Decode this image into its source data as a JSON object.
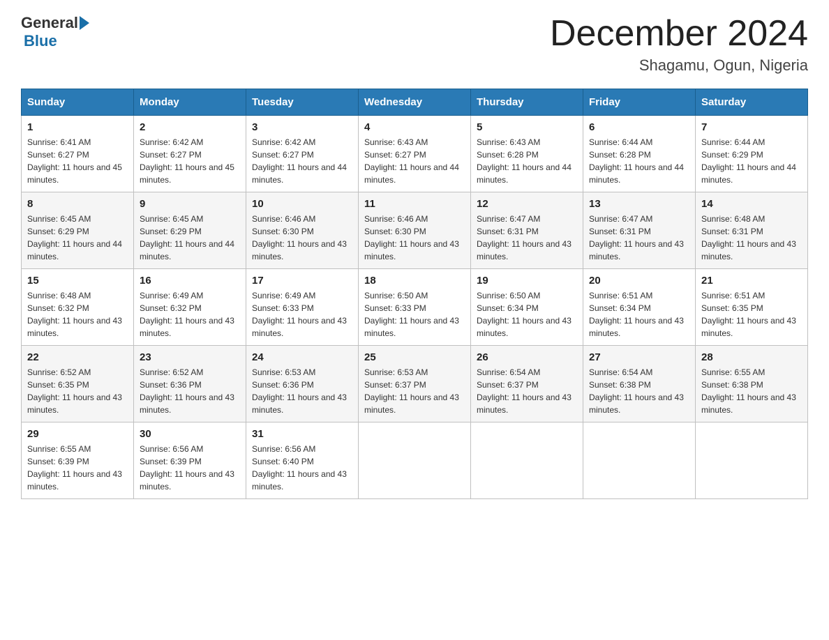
{
  "logo": {
    "general": "General",
    "blue": "Blue"
  },
  "title": "December 2024",
  "subtitle": "Shagamu, Ogun, Nigeria",
  "days_of_week": [
    "Sunday",
    "Monday",
    "Tuesday",
    "Wednesday",
    "Thursday",
    "Friday",
    "Saturday"
  ],
  "weeks": [
    [
      {
        "day": "1",
        "sunrise": "6:41 AM",
        "sunset": "6:27 PM",
        "daylight": "11 hours and 45 minutes."
      },
      {
        "day": "2",
        "sunrise": "6:42 AM",
        "sunset": "6:27 PM",
        "daylight": "11 hours and 45 minutes."
      },
      {
        "day": "3",
        "sunrise": "6:42 AM",
        "sunset": "6:27 PM",
        "daylight": "11 hours and 44 minutes."
      },
      {
        "day": "4",
        "sunrise": "6:43 AM",
        "sunset": "6:27 PM",
        "daylight": "11 hours and 44 minutes."
      },
      {
        "day": "5",
        "sunrise": "6:43 AM",
        "sunset": "6:28 PM",
        "daylight": "11 hours and 44 minutes."
      },
      {
        "day": "6",
        "sunrise": "6:44 AM",
        "sunset": "6:28 PM",
        "daylight": "11 hours and 44 minutes."
      },
      {
        "day": "7",
        "sunrise": "6:44 AM",
        "sunset": "6:29 PM",
        "daylight": "11 hours and 44 minutes."
      }
    ],
    [
      {
        "day": "8",
        "sunrise": "6:45 AM",
        "sunset": "6:29 PM",
        "daylight": "11 hours and 44 minutes."
      },
      {
        "day": "9",
        "sunrise": "6:45 AM",
        "sunset": "6:29 PM",
        "daylight": "11 hours and 44 minutes."
      },
      {
        "day": "10",
        "sunrise": "6:46 AM",
        "sunset": "6:30 PM",
        "daylight": "11 hours and 43 minutes."
      },
      {
        "day": "11",
        "sunrise": "6:46 AM",
        "sunset": "6:30 PM",
        "daylight": "11 hours and 43 minutes."
      },
      {
        "day": "12",
        "sunrise": "6:47 AM",
        "sunset": "6:31 PM",
        "daylight": "11 hours and 43 minutes."
      },
      {
        "day": "13",
        "sunrise": "6:47 AM",
        "sunset": "6:31 PM",
        "daylight": "11 hours and 43 minutes."
      },
      {
        "day": "14",
        "sunrise": "6:48 AM",
        "sunset": "6:31 PM",
        "daylight": "11 hours and 43 minutes."
      }
    ],
    [
      {
        "day": "15",
        "sunrise": "6:48 AM",
        "sunset": "6:32 PM",
        "daylight": "11 hours and 43 minutes."
      },
      {
        "day": "16",
        "sunrise": "6:49 AM",
        "sunset": "6:32 PM",
        "daylight": "11 hours and 43 minutes."
      },
      {
        "day": "17",
        "sunrise": "6:49 AM",
        "sunset": "6:33 PM",
        "daylight": "11 hours and 43 minutes."
      },
      {
        "day": "18",
        "sunrise": "6:50 AM",
        "sunset": "6:33 PM",
        "daylight": "11 hours and 43 minutes."
      },
      {
        "day": "19",
        "sunrise": "6:50 AM",
        "sunset": "6:34 PM",
        "daylight": "11 hours and 43 minutes."
      },
      {
        "day": "20",
        "sunrise": "6:51 AM",
        "sunset": "6:34 PM",
        "daylight": "11 hours and 43 minutes."
      },
      {
        "day": "21",
        "sunrise": "6:51 AM",
        "sunset": "6:35 PM",
        "daylight": "11 hours and 43 minutes."
      }
    ],
    [
      {
        "day": "22",
        "sunrise": "6:52 AM",
        "sunset": "6:35 PM",
        "daylight": "11 hours and 43 minutes."
      },
      {
        "day": "23",
        "sunrise": "6:52 AM",
        "sunset": "6:36 PM",
        "daylight": "11 hours and 43 minutes."
      },
      {
        "day": "24",
        "sunrise": "6:53 AM",
        "sunset": "6:36 PM",
        "daylight": "11 hours and 43 minutes."
      },
      {
        "day": "25",
        "sunrise": "6:53 AM",
        "sunset": "6:37 PM",
        "daylight": "11 hours and 43 minutes."
      },
      {
        "day": "26",
        "sunrise": "6:54 AM",
        "sunset": "6:37 PM",
        "daylight": "11 hours and 43 minutes."
      },
      {
        "day": "27",
        "sunrise": "6:54 AM",
        "sunset": "6:38 PM",
        "daylight": "11 hours and 43 minutes."
      },
      {
        "day": "28",
        "sunrise": "6:55 AM",
        "sunset": "6:38 PM",
        "daylight": "11 hours and 43 minutes."
      }
    ],
    [
      {
        "day": "29",
        "sunrise": "6:55 AM",
        "sunset": "6:39 PM",
        "daylight": "11 hours and 43 minutes."
      },
      {
        "day": "30",
        "sunrise": "6:56 AM",
        "sunset": "6:39 PM",
        "daylight": "11 hours and 43 minutes."
      },
      {
        "day": "31",
        "sunrise": "6:56 AM",
        "sunset": "6:40 PM",
        "daylight": "11 hours and 43 minutes."
      },
      null,
      null,
      null,
      null
    ]
  ],
  "labels": {
    "sunrise": "Sunrise:",
    "sunset": "Sunset:",
    "daylight": "Daylight:"
  }
}
